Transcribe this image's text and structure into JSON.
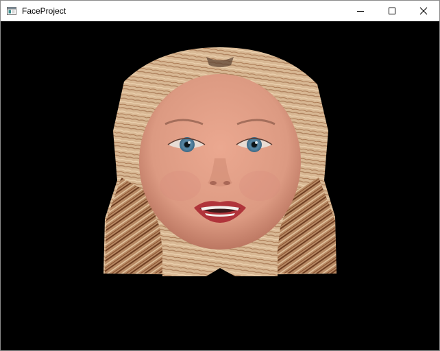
{
  "window": {
    "title": "FaceProject",
    "app_icon": "window-app-icon",
    "controls": {
      "minimize": "minimize-icon",
      "maximize": "maximize-icon",
      "close": "close-icon"
    }
  },
  "viewport": {
    "content": "rendered-3d-face-model",
    "background_color": "#000000"
  },
  "colors": {
    "hair_light": "#d8b894",
    "hair_mid": "#c49a72",
    "hair_dark": "#7a4a2c",
    "skin": "#e0a088",
    "skin_shade": "#c98670",
    "iris": "#5a8aa8",
    "lips": "#b0343a"
  }
}
